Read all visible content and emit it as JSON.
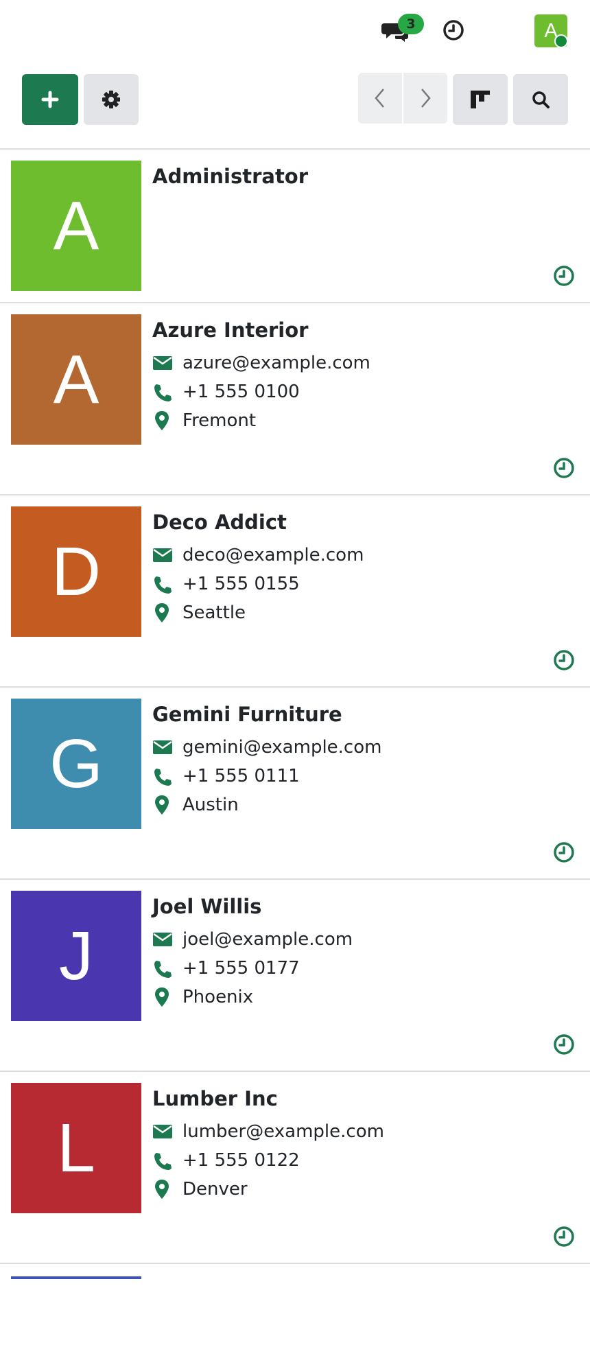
{
  "header": {
    "message_count": "3",
    "user_initial": "A"
  },
  "colors": {
    "accent": "#1d7a50",
    "badge": "#28a745",
    "presence": "#0f8a3a",
    "divider": "#dcdfe2"
  },
  "controls": {
    "new_icon": "plus-icon",
    "settings_icon": "gear-icon",
    "prev_icon": "chevron-left-icon",
    "next_icon": "chevron-right-icon",
    "view_icon": "kanban-icon",
    "search_icon": "search-icon"
  },
  "contacts": [
    {
      "initial": "A",
      "name": "Administrator",
      "color": "#6dbd2f"
    },
    {
      "initial": "A",
      "name": "Azure Interior",
      "email": "azure@example.com",
      "phone": "+1 555 0100",
      "city": "Fremont",
      "color": "#b36731"
    },
    {
      "initial": "D",
      "name": "Deco Addict",
      "email": "deco@example.com",
      "phone": "+1 555 0155",
      "city": "Seattle",
      "color": "#c45c22"
    },
    {
      "initial": "G",
      "name": "Gemini Furniture",
      "email": "gemini@example.com",
      "phone": "+1 555 0111",
      "city": "Austin",
      "color": "#3e8dae"
    },
    {
      "initial": "J",
      "name": "Joel Willis",
      "email": "joel@example.com",
      "phone": "+1 555 0177",
      "city": "Phoenix",
      "color": "#4a37b0"
    },
    {
      "initial": "L",
      "name": "Lumber Inc",
      "email": "lumber@example.com",
      "phone": "+1 555 0122",
      "city": "Denver",
      "color": "#b82a31"
    }
  ]
}
